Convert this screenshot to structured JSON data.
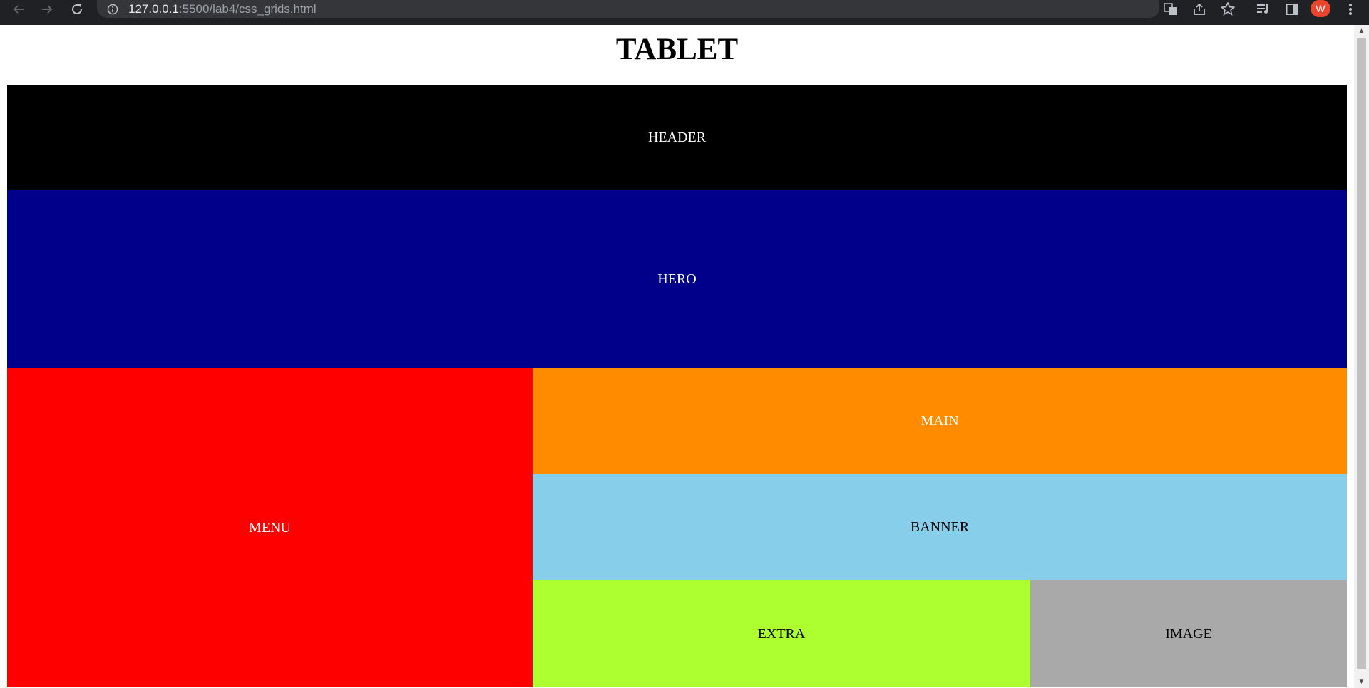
{
  "browser": {
    "url_host": "127.0.0.1",
    "url_rest": ":5500/lab4/css_grids.html",
    "profile_initial": "W",
    "icons": [
      "back-icon",
      "forward-icon",
      "reload-icon",
      "info-icon",
      "translate-icon",
      "share-icon",
      "star-icon",
      "reading-list-icon",
      "side-panel-icon",
      "menu-icon"
    ]
  },
  "page": {
    "title": "TABLET",
    "sections": {
      "header": "HEADER",
      "hero": "HERO",
      "menu": "MENU",
      "main": "MAIN",
      "banner": "BANNER",
      "extra": "EXTRA",
      "image": "IMAGE"
    }
  },
  "colors": {
    "header": "#000000",
    "hero": "#00008b",
    "menu": "#ff0000",
    "main": "#ff8c00",
    "banner": "#87ceeb",
    "extra": "#adff2f",
    "image": "#a9a9a9"
  }
}
